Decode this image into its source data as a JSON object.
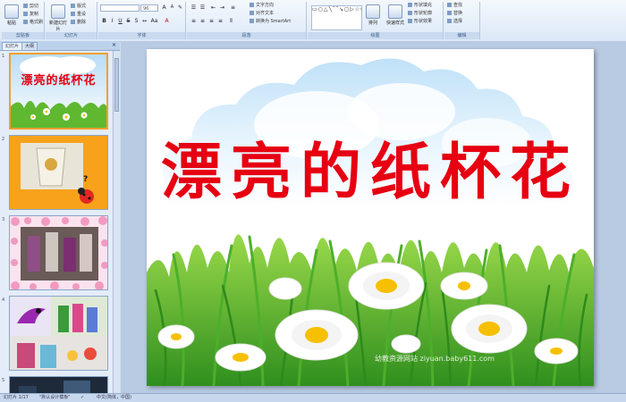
{
  "ribbon": {
    "clipboard": {
      "label": "剪贴板",
      "paste": "粘贴",
      "cut": "剪切",
      "copy": "复制",
      "format": "格式刷"
    },
    "slides": {
      "label": "幻灯片",
      "new_slide": "新建幻灯片",
      "layout": "版式",
      "reset": "重设",
      "delete": "删除"
    },
    "font": {
      "label": "字体",
      "font_size": "96"
    },
    "paragraph": {
      "label": "段落",
      "text_direction": "文字方向",
      "align_text": "对齐文本",
      "smartart": "转换为 SmartArt"
    },
    "drawing": {
      "label": "绘图",
      "arrange": "排列",
      "quick_styles": "快速样式",
      "shape_fill": "形状填充",
      "shape_outline": "形状轮廓",
      "shape_effects": "形状效果"
    },
    "editing": {
      "label": "编辑",
      "find": "查找",
      "replace": "替换",
      "select": "选择"
    }
  },
  "panel": {
    "tab_slides": "幻灯片",
    "tab_outline": "大纲"
  },
  "thumbnails": [
    {
      "number": "1",
      "title": "漂亮的纸杯花"
    },
    {
      "number": "2",
      "label": "?"
    },
    {
      "number": "3"
    },
    {
      "number": "4"
    },
    {
      "number": "5"
    }
  ],
  "slide": {
    "title": "漂亮的纸杯花",
    "watermark": "幼教资源网站 ziyuan.baby611.com"
  },
  "status": {
    "slide_count": "幻灯片 1/17",
    "theme": "\"默认设计模板\"",
    "language": "中文(简体，中国)"
  }
}
